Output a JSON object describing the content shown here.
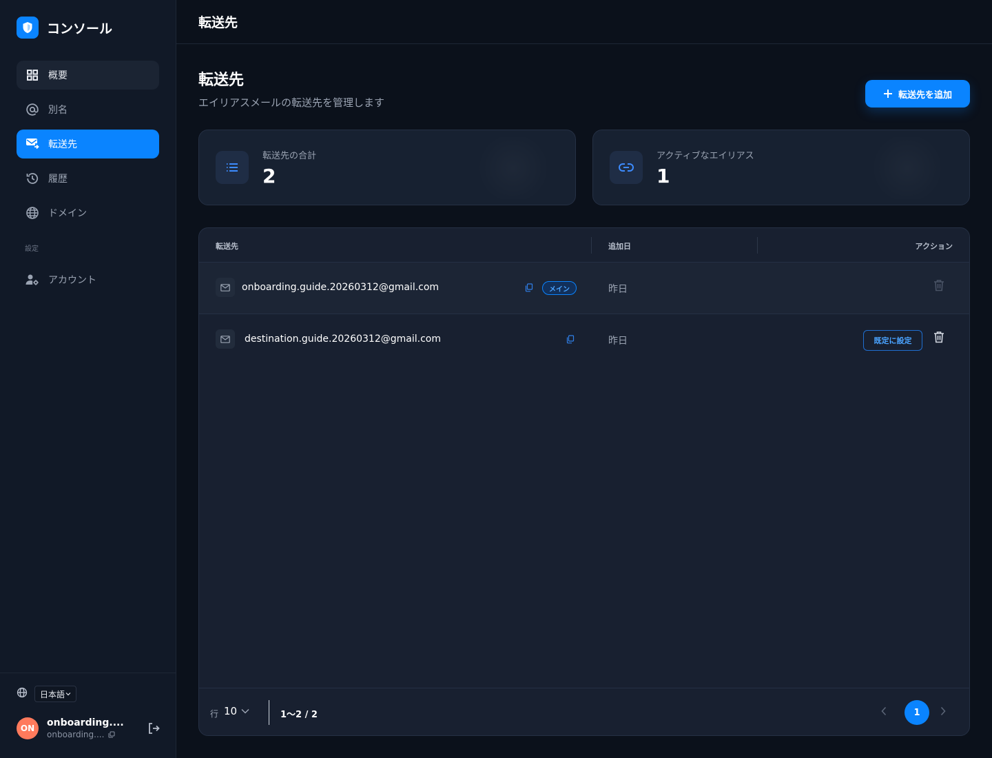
{
  "app": {
    "name": "コンソール"
  },
  "sidebar": {
    "items": [
      {
        "label": "概要",
        "icon": "grid-icon"
      },
      {
        "label": "別名",
        "icon": "at-icon"
      },
      {
        "label": "転送先",
        "icon": "mail-forward-icon"
      },
      {
        "label": "履歴",
        "icon": "history-icon"
      },
      {
        "label": "ドメイン",
        "icon": "globe-icon"
      }
    ],
    "section_label": "設定",
    "settings_items": [
      {
        "label": "アカウント",
        "icon": "account-settings-icon"
      }
    ],
    "language": "日本語",
    "user": {
      "name": "onboarding....",
      "sub": "onboarding....",
      "initials": "ON"
    }
  },
  "topbar": {
    "title": "転送先"
  },
  "page": {
    "title": "転送先",
    "subtitle": "エイリアスメールの転送先を管理します",
    "add_button": "転送先を追加"
  },
  "stats": [
    {
      "label": "転送先の合計",
      "value": "2"
    },
    {
      "label": "アクティブなエイリアス",
      "value": "1"
    }
  ],
  "table": {
    "headers": {
      "destination": "転送先",
      "added": "追加日",
      "actions": "アクション"
    },
    "rows": [
      {
        "email": "onboarding.guide.20260312@gmail.com",
        "added": "昨日",
        "badge": "メイン"
      },
      {
        "email": "destination.guide.20260312@gmail.com",
        "added": "昨日",
        "action": "既定に設定"
      }
    ],
    "footer": {
      "rows_label": "行",
      "rows_per_page": "10",
      "range": "1〜2 / 2",
      "current_page": "1"
    }
  },
  "colors": {
    "accent": "#0a84ff",
    "sidebar_bg": "#111927",
    "page_bg": "#0b111b",
    "avatar": "#ff7a5c"
  }
}
